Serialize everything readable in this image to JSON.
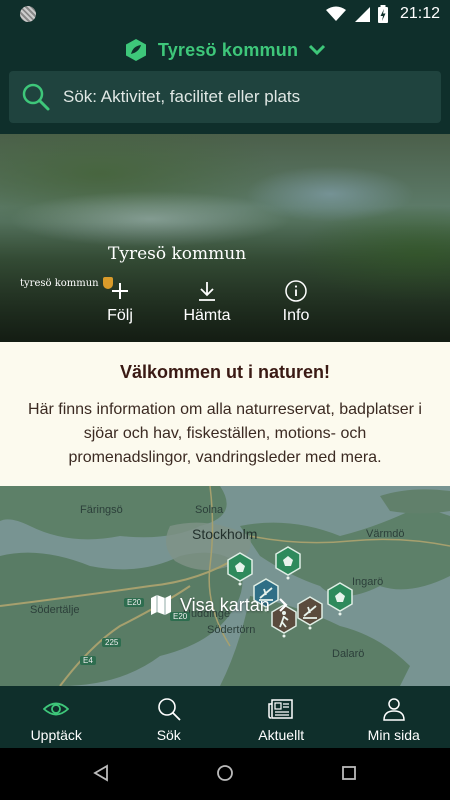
{
  "status_bar": {
    "time": "21:12"
  },
  "header": {
    "brand_title": "Tyresö kommun",
    "search_placeholder": "Sök: Aktivitet, facilitet eller plats"
  },
  "hero": {
    "title": "Tyresö kommun",
    "logo_text": "tyresö kommun",
    "actions": [
      {
        "label": "Följ",
        "icon": "plus-icon"
      },
      {
        "label": "Hämta",
        "icon": "download-icon"
      },
      {
        "label": "Info",
        "icon": "info-icon"
      }
    ]
  },
  "welcome": {
    "heading": "Välkommen ut i naturen!",
    "body": "Här finns information om alla naturreservat, badplatser i sjöar och hav, fiskeställen, motions- och promenadslingor, vandringsleder med mera."
  },
  "map": {
    "labels": {
      "faringso": "Färingsö",
      "solna": "Solna",
      "stockholm": "Stockholm",
      "varmdo": "Värmdö",
      "ingaro": "Ingarö",
      "huddinge": "Huddinge",
      "sodertalje": "Södertälje",
      "sodertorn": "Södertörn",
      "dalaro": "Dalarö"
    },
    "road_badges": [
      "E20",
      "E20",
      "225",
      "E4"
    ],
    "cta": "Visa kartan"
  },
  "bottom_nav": [
    {
      "label": "Upptäck",
      "icon": "eye-icon"
    },
    {
      "label": "Sök",
      "icon": "search-icon"
    },
    {
      "label": "Aktuellt",
      "icon": "newspaper-icon"
    },
    {
      "label": "Min sida",
      "icon": "person-icon"
    }
  ],
  "colors": {
    "header_bg": "#0f2f2b",
    "brand_green": "#3ec77a",
    "search_bg": "#1f433e",
    "welcome_bg": "#fcfaee",
    "welcome_heading": "#3a1a14",
    "pin_green": "#2e8a5c",
    "pin_brown": "#5a4b3d"
  }
}
